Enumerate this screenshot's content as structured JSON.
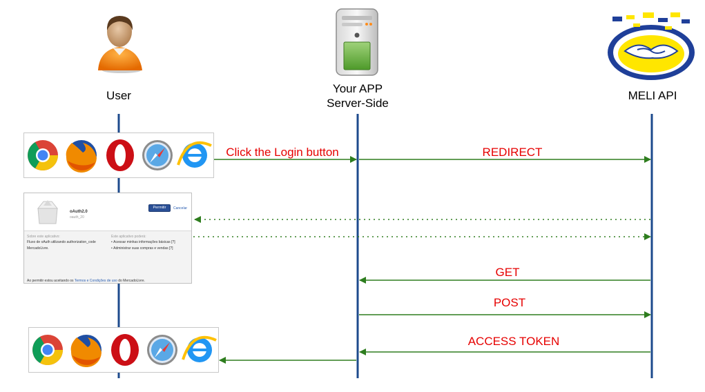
{
  "actors": {
    "user": "User",
    "app_line1": "Your APP",
    "app_line2": "Server-Side",
    "api": "MELI API"
  },
  "messages": {
    "click_login": "Click the Login button",
    "redirect": "REDIRECT",
    "get": "GET",
    "post": "POST",
    "access_token": "ACCESS TOKEN"
  },
  "auth_dialog": {
    "app_name": "oAuth2.0",
    "app_sub": "oauth_20",
    "allow_button": "Permitir",
    "cancel_link": "Cancelar",
    "left_heading": "Sobre este aplicativo:",
    "left_text_1": "Fluxo de oAuth utilizando authorization_code",
    "left_text_2": "MercadoLivre.",
    "right_heading": "Este aplicativo poderá:",
    "right_item_1": "Acessar minhas informações básicas [?]",
    "right_item_2": "Administrar suas compras e vendas [?]",
    "footer_prefix": "Ao permitir estou aceitando os",
    "footer_link": "Termos e Condições de uso",
    "footer_suffix": "do MercadoLivre."
  },
  "browser_icons": [
    "chrome-icon",
    "firefox-icon",
    "opera-icon",
    "safari-icon",
    "ie-icon"
  ],
  "colors": {
    "lifeline": "#1c4a8c",
    "arrow": "#2e7d1e",
    "message_text": "#e60000"
  }
}
